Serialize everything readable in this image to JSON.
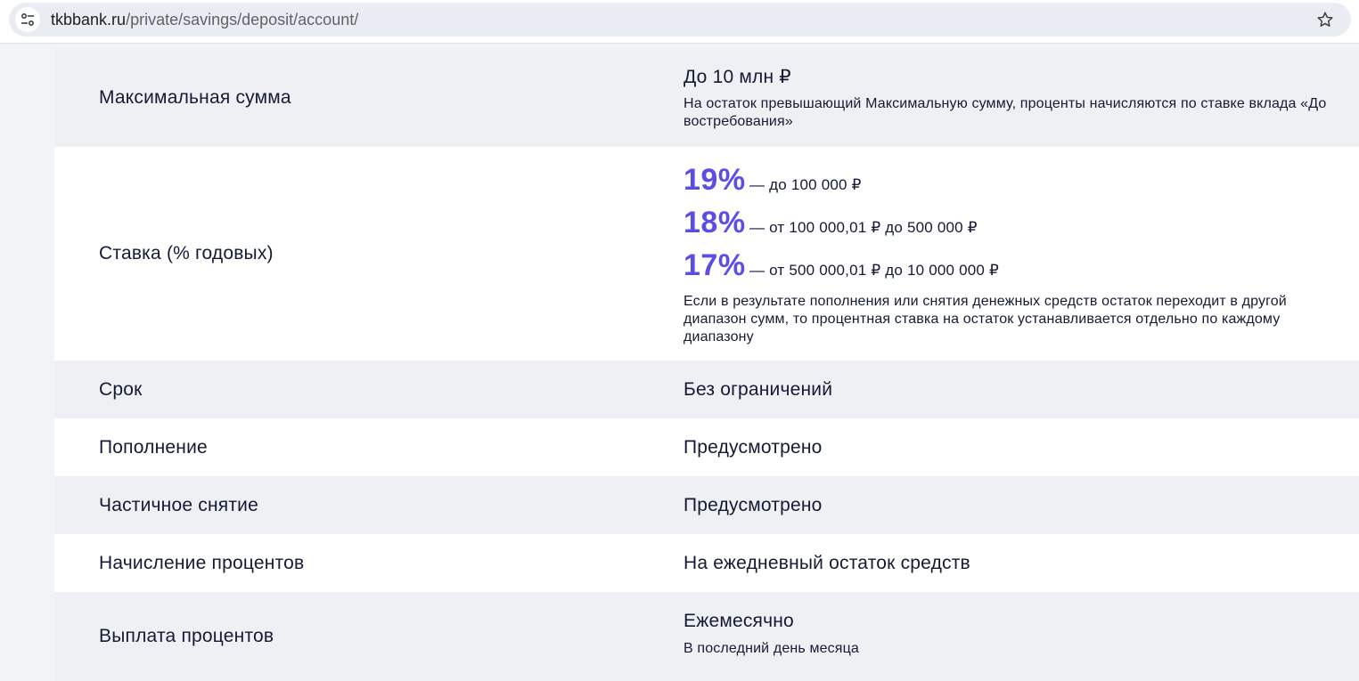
{
  "browser": {
    "url_domain": "tkbbank.ru",
    "url_path": "/private/savings/deposit/account/"
  },
  "terms": {
    "max_amount": {
      "label": "Максимальная сумма",
      "value": "До 10 млн ₽",
      "note": "На остаток превышающий Максимальную сумму, проценты начисляются по ставке вклада «До востребования»"
    },
    "rate": {
      "label": "Ставка (% годовых)",
      "tiers": [
        {
          "percent": "19%",
          "range": "— до 100 000 ₽"
        },
        {
          "percent": "18%",
          "range": "— от 100 000,01 ₽ до 500 000 ₽"
        },
        {
          "percent": "17%",
          "range": "— от 500 000,01 ₽ до 10 000 000 ₽"
        }
      ],
      "note": "Если в результате пополнения или снятия денежных средств остаток переходит в другой диапазон сумм, то процентная ставка на остаток устанавливается отдельно по каждому диапазону"
    },
    "term": {
      "label": "Срок",
      "value": "Без ограничений"
    },
    "top_up": {
      "label": "Пополнение",
      "value": "Предусмотрено"
    },
    "partial_withdrawal": {
      "label": "Частичное снятие",
      "value": "Предусмотрено"
    },
    "interest_accrual": {
      "label": "Начисление процентов",
      "value": "На ежедневный остаток средств"
    },
    "interest_payout": {
      "label": "Выплата процентов",
      "value": "Ежемесячно",
      "note": "В последний день месяца"
    }
  },
  "colors": {
    "accent": "#5b4ee8",
    "text": "#151a35",
    "row_grey": "#eef0f4",
    "row_white": "#ffffff"
  },
  "icons": {
    "site_info": "tune-icon",
    "bookmark": "star-outline-icon"
  }
}
